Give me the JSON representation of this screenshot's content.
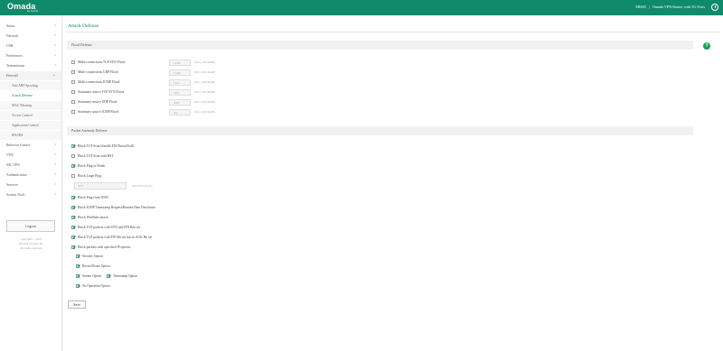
{
  "header": {
    "logo": "Omada",
    "logo_sub": "by tp-link",
    "model": "ER605",
    "product": "Omada VPN Router with 5G Ports",
    "logout_icon": "power-icon"
  },
  "sidebar": {
    "items": [
      {
        "label": "Status",
        "chevron": "›"
      },
      {
        "label": "Network",
        "chevron": "›"
      },
      {
        "label": "USB",
        "chevron": "›"
      },
      {
        "label": "Preferences",
        "chevron": "›"
      },
      {
        "label": "Transmission",
        "chevron": "›"
      },
      {
        "label": "Firewall",
        "chevron": "⌄"
      },
      {
        "label": "Behavior Control",
        "chevron": "›"
      },
      {
        "label": "VPN",
        "chevron": "›"
      },
      {
        "label": "SSL VPN",
        "chevron": "›"
      },
      {
        "label": "Authentication",
        "chevron": "›"
      },
      {
        "label": "Services",
        "chevron": "›"
      },
      {
        "label": "System Tools",
        "chevron": "›"
      }
    ],
    "firewall_sub": [
      "Anti ARP Spoofing",
      "Attack Defense",
      "MAC Filtering",
      "Access Control",
      "Application Control",
      "IPS/IDS"
    ],
    "logout": "Logout",
    "copyright": [
      "Copyright © 2021",
      "TP-Link Systems Inc.",
      "All rights reserved."
    ]
  },
  "main": {
    "title": "Attack Defense",
    "help_icon": "?",
    "flood": {
      "header": "Flood Defense",
      "rows": [
        {
          "label": "Multi-connections TCP SYN Flood",
          "value": "10000",
          "hint": "Pkt/s (100-99999)"
        },
        {
          "label": "Multi-connections UDP Flood",
          "value": "10000",
          "hint": "Pkt/s (100-99999)"
        },
        {
          "label": "Multi-connections ICMP Flood",
          "value": "1000",
          "hint": "Pkt/s (100-99999)"
        },
        {
          "label": "Stationary source TCP SYN Flood",
          "value": "5000",
          "hint": "Pkt/s (100-99999)"
        },
        {
          "label": "Stationary source UDP Flood",
          "value": "5000",
          "hint": "Pkt/s (100-99999)"
        },
        {
          "label": "Stationary source ICMP Flood",
          "value": "500",
          "hint": "Pkt/s (100-99999)"
        }
      ]
    },
    "packet": {
      "header": "Packet Anomaly Defense",
      "rows": [
        {
          "label": "Block TCP Scan (Stealth FIN/Xmas/Null)",
          "checked": true
        },
        {
          "label": "Block TCP Scan with RST",
          "checked": false
        },
        {
          "label": "Block Ping of Death",
          "checked": true
        },
        {
          "label": "Block Large Ping",
          "checked": false
        }
      ],
      "large_ping_value": "3000",
      "large_ping_hint": "(64-65535 Bytes)",
      "rows2": [
        {
          "label": "Block Ping from WAN",
          "checked": true
        },
        {
          "label": "Block ICMP Timestamp Request/Remote Date Disclosure",
          "checked": true
        },
        {
          "label": "Block WinNuke attack",
          "checked": true
        },
        {
          "label": "Block TCP packets with SYN and FIN Bits set",
          "checked": true
        },
        {
          "label": "Block TCP packets with FIN Bit set but no ACK Bit set",
          "checked": true
        },
        {
          "label": "Block packets with specified IP options",
          "checked": true
        }
      ],
      "options": {
        "security": {
          "label": "Security Option",
          "checked": true
        },
        "record_route": {
          "label": "Record Route Option",
          "checked": true
        },
        "stream": {
          "label": "Stream Option",
          "checked": true
        },
        "timestamp": {
          "label": "Timestamp Option",
          "checked": true
        },
        "no_operation": {
          "label": "No Operation Option",
          "checked": true
        }
      }
    },
    "save": "Save"
  }
}
